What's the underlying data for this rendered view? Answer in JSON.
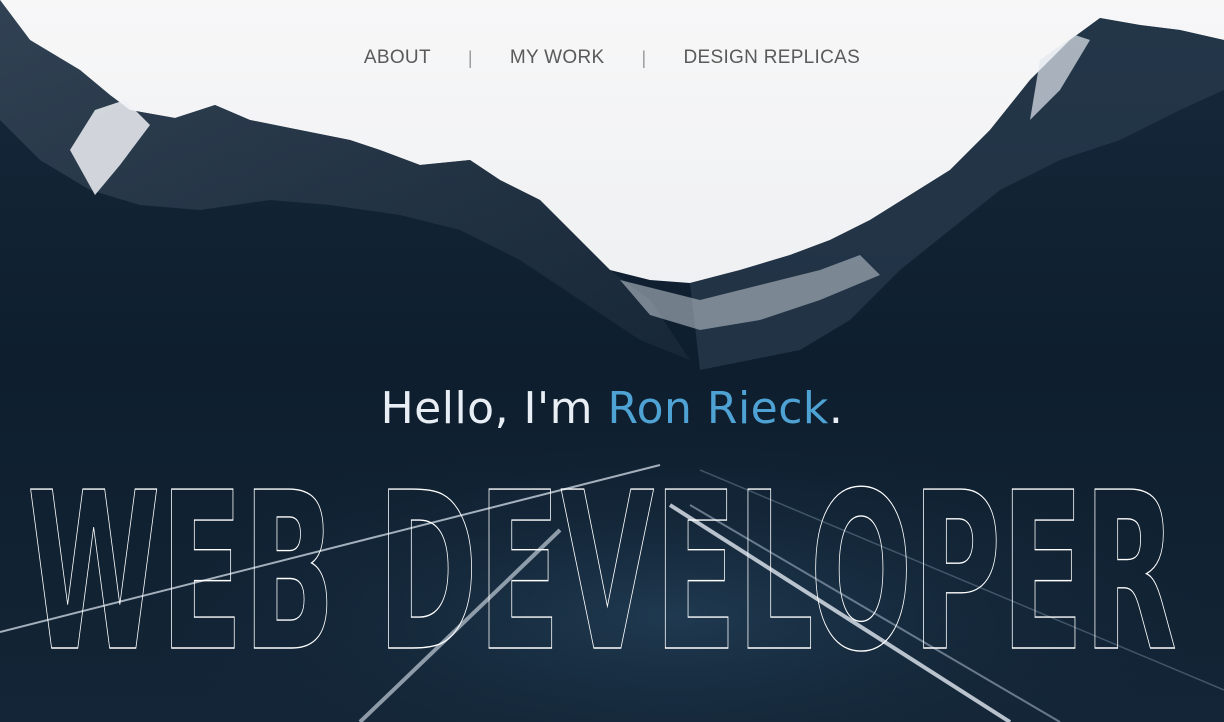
{
  "nav": {
    "items": [
      {
        "label": "ABOUT"
      },
      {
        "label": "MY WORK"
      },
      {
        "label": "DESIGN REPLICAS"
      }
    ],
    "separator": "|"
  },
  "hero": {
    "greeting_prefix": "Hello, I'm ",
    "name": "Ron Rieck",
    "greeting_suffix": ".",
    "title": "WEB DEVELOPER"
  },
  "colors": {
    "accent": "#4ea3d4",
    "sky": "#f2f3f4",
    "mountain": "#0f2233"
  }
}
